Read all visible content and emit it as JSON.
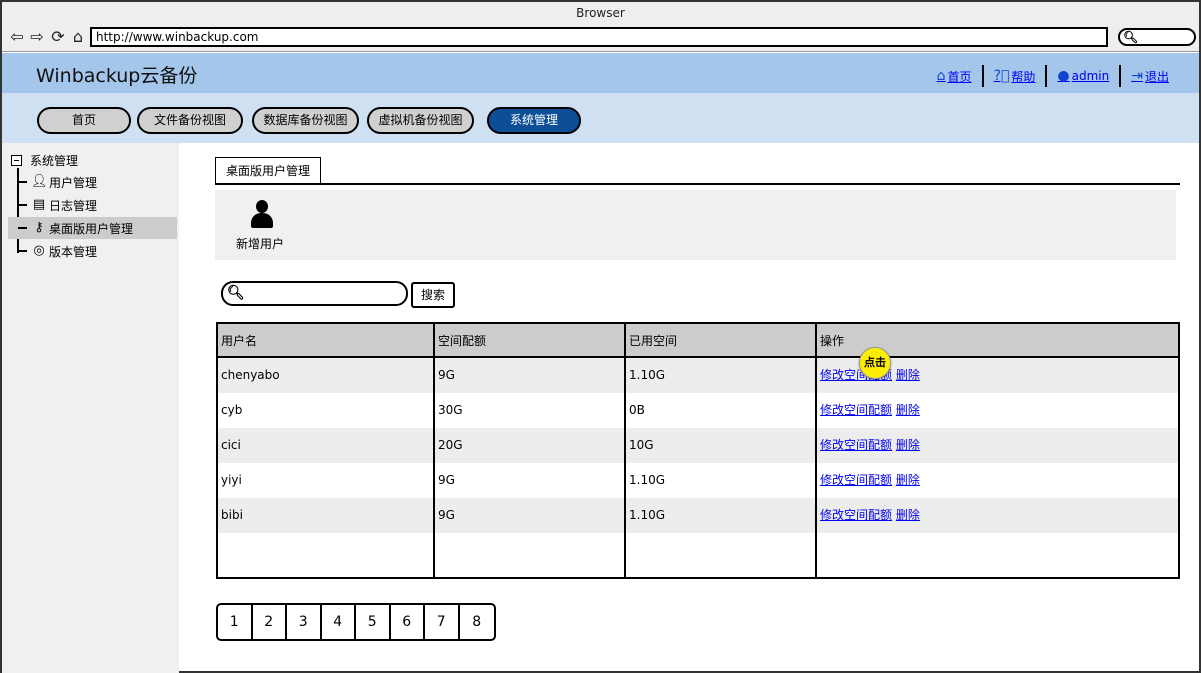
{
  "browser": {
    "title": "Browser",
    "url": "http://www.winbackup.com"
  },
  "app": {
    "title": "Winbackup云备份",
    "header_links": {
      "home": "首页",
      "help": "帮助",
      "user": "admin",
      "logout": "退出"
    }
  },
  "menu": {
    "items": [
      "首页",
      "文件备份视图",
      "数据库备份视图",
      "虚拟机备份视图",
      "系统管理"
    ],
    "active": "系统管理"
  },
  "sidebar": {
    "root": "系统管理",
    "items": [
      {
        "label": "用户管理",
        "icon": "user-icon"
      },
      {
        "label": "日志管理",
        "icon": "clipboard-icon"
      },
      {
        "label": "桌面版用户管理",
        "icon": "key-icon"
      },
      {
        "label": "版本管理",
        "icon": "disc-icon"
      }
    ],
    "selected": "桌面版用户管理"
  },
  "tab": {
    "label": "桌面版用户管理"
  },
  "toolbar": {
    "add_user_label": "新增用户"
  },
  "search": {
    "button_label": "搜索",
    "value": ""
  },
  "table": {
    "columns": [
      "用户名",
      "空间配额",
      "已用空间",
      "操作"
    ],
    "rows": [
      {
        "username": "chenyabo",
        "quota": "9G",
        "used": "1.10G"
      },
      {
        "username": "cyb",
        "quota": "30G",
        "used": "0B"
      },
      {
        "username": "cici",
        "quota": "20G",
        "used": "10G"
      },
      {
        "username": "yiyi",
        "quota": "9G",
        "used": "1.10G"
      },
      {
        "username": "bibi",
        "quota": "9G",
        "used": "1.10G"
      }
    ],
    "actions": {
      "edit": "修改空间配额",
      "delete": "删除"
    }
  },
  "click_marker": "点击",
  "pagination": [
    "1",
    "2",
    "3",
    "4",
    "5",
    "6",
    "7",
    "8"
  ],
  "colors": {
    "header_bg": "#a4c6ea",
    "menu_bg": "#cfe0f3",
    "active_menu": "#0d4f96",
    "link": "#0000ee",
    "marker": "#ffee00"
  }
}
